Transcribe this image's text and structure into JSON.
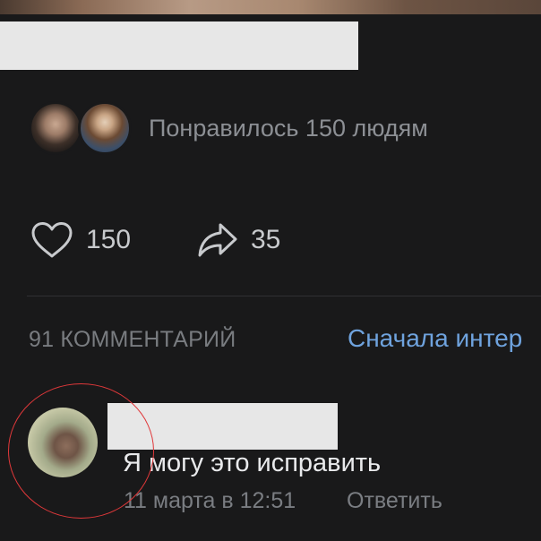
{
  "post": {
    "likes_summary": "Понравилось 150 людям",
    "like_count": "150",
    "share_count": "35",
    "liker_avatars": [
      "avatar",
      "avatar"
    ]
  },
  "comments": {
    "count_label": "91 КОММЕНТАРИЙ",
    "sort_label": "Сначала интер",
    "items": [
      {
        "text": "Я могу это исправить",
        "date": "11 марта в 12:51",
        "reply_label": "Ответить"
      }
    ]
  },
  "colors": {
    "background": "#19191a",
    "accent": "#6fa3de",
    "annotation_circle": "#e0383a",
    "redaction": "#e7e7e7"
  },
  "icons": {
    "like": "heart-icon",
    "share": "share-arrow-icon"
  }
}
